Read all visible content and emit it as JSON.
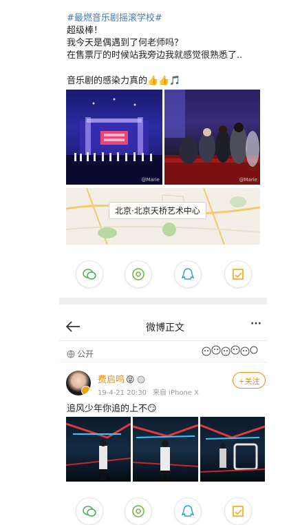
{
  "post1": {
    "hashtag": "#最燃音乐剧摇滚学校#",
    "line1": "超级棒！",
    "line2": "我今天是偶遇到了何老师吗？",
    "line3": "在售票厅的时候站我旁边我就感觉很熟悉了..",
    "line4": "音乐剧的感染力真的👍👍🎵",
    "photo_watermark_1": "@Marie",
    "photo_watermark_2": "@Marie",
    "map_location": "北京·北京天桥艺术中心"
  },
  "share_icons": [
    "wechat-icon",
    "moments-icon",
    "qq-icon",
    "save-icon"
  ],
  "detail_header": {
    "title": "微博正文",
    "more": "···"
  },
  "visibility": "公开",
  "post2": {
    "username": "费启鸣",
    "emoji": "😝",
    "time": "19-4-21 20:30",
    "source": "来自 iPhone X",
    "follow_label": "+关注",
    "text": "追风少年你追的上不😏"
  },
  "colors": {
    "hashtag": "#4a7bb7",
    "follow": "#f28b00",
    "username": "#f28b00"
  }
}
